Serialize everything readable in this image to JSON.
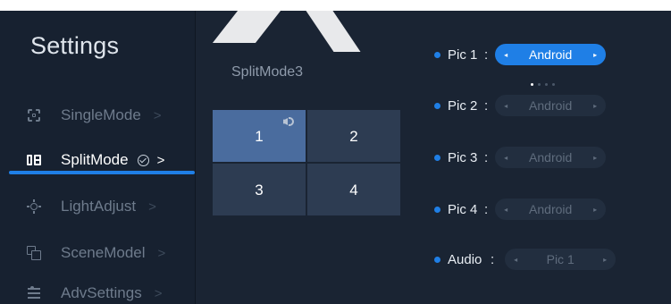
{
  "sidebar": {
    "title": "Settings",
    "items": [
      {
        "label": "SingleMode",
        "icon": "single-mode-icon"
      },
      {
        "label": "SplitMode",
        "icon": "split-mode-icon",
        "active": true,
        "checked": true
      },
      {
        "label": "LightAdjust",
        "icon": "light-adjust-icon"
      },
      {
        "label": "SceneModel",
        "icon": "scene-model-icon"
      },
      {
        "label": "AdvSettings",
        "icon": "adv-settings-icon"
      }
    ],
    "chevron": ">"
  },
  "preview": {
    "mode_title": "SplitMode3",
    "cells": [
      "1",
      "2",
      "3",
      "4"
    ],
    "selected_cell": "1",
    "audio_cell": "1"
  },
  "sources": {
    "rows": [
      {
        "label": "Pic 1",
        "value": "Android",
        "active": true
      },
      {
        "label": "Pic 2",
        "value": "Android"
      },
      {
        "label": "Pic 3",
        "value": "Android"
      },
      {
        "label": "Pic 4",
        "value": "Android"
      }
    ],
    "audio": {
      "label": "Audio",
      "value": "Pic 1"
    },
    "colon": ":",
    "arrow_left": "◂",
    "arrow_right": "▸",
    "pager_pages": 4,
    "pager_current": 1
  },
  "colors": {
    "accent": "#1f7fe6",
    "background": "#1a2433",
    "sidebar": "#172130",
    "selected_cell": "#4a6c9e"
  }
}
